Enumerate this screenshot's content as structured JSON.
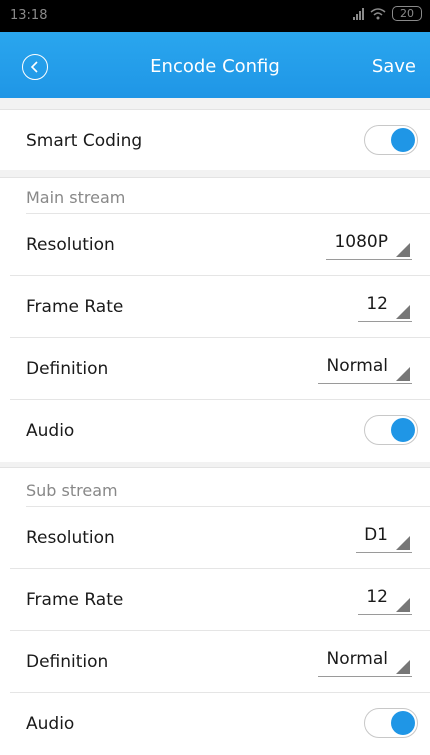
{
  "status_bar": {
    "time": "13:18",
    "battery": "20"
  },
  "header": {
    "title": "Encode Config",
    "save_label": "Save"
  },
  "smart_coding": {
    "label": "Smart Coding",
    "enabled": true
  },
  "main_stream": {
    "section_label": "Main stream",
    "resolution": {
      "label": "Resolution",
      "value": "1080P"
    },
    "frame_rate": {
      "label": "Frame Rate",
      "value": "12"
    },
    "definition": {
      "label": "Definition",
      "value": "Normal"
    },
    "audio": {
      "label": "Audio",
      "enabled": true
    }
  },
  "sub_stream": {
    "section_label": "Sub stream",
    "resolution": {
      "label": "Resolution",
      "value": "D1"
    },
    "frame_rate": {
      "label": "Frame Rate",
      "value": "12"
    },
    "definition": {
      "label": "Definition",
      "value": "Normal"
    },
    "audio": {
      "label": "Audio",
      "enabled": true
    }
  },
  "colors": {
    "accent": "#1f96e6",
    "header": "#2aa6ee"
  }
}
